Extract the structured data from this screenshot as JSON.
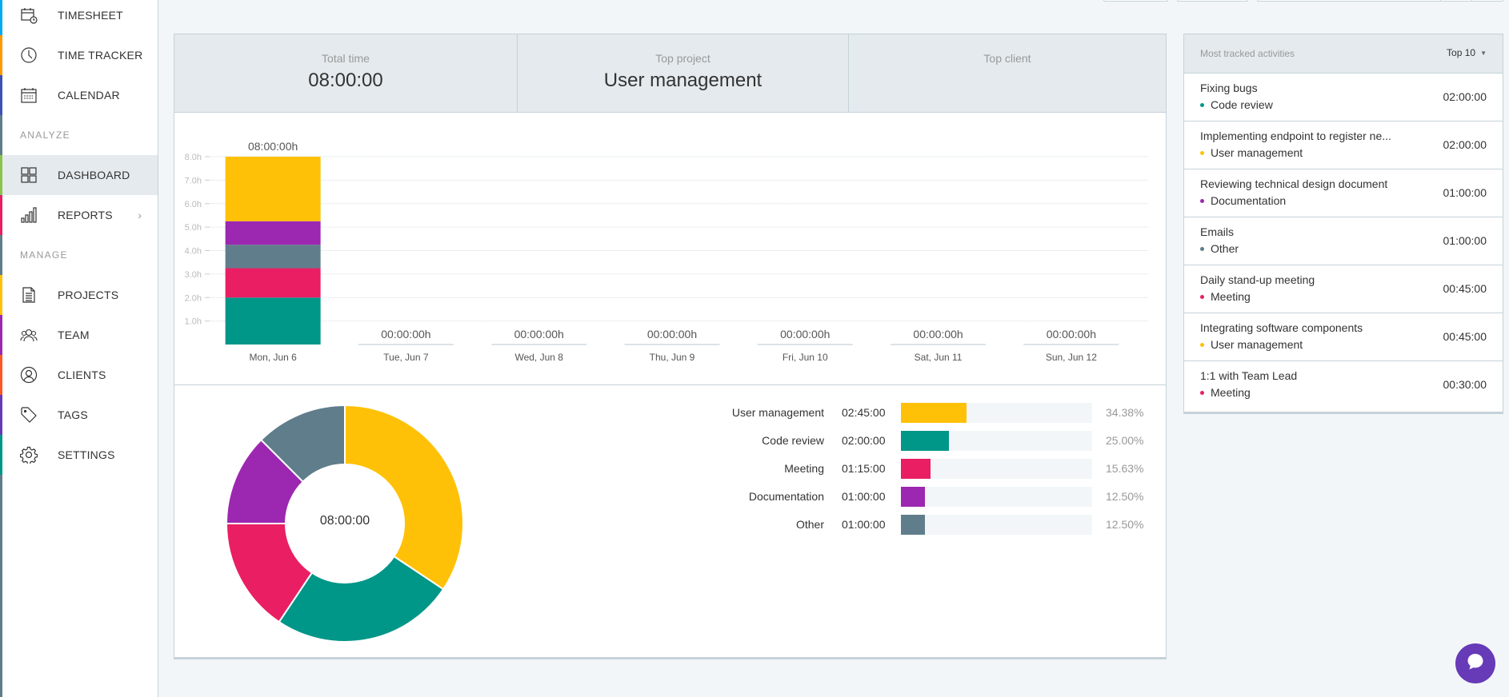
{
  "sidebar": {
    "items": [
      {
        "key": "timesheet",
        "label": "TIMESHEET",
        "icon": "timesheet-icon",
        "color": "#03a9f4"
      },
      {
        "key": "time-tracker",
        "label": "TIME TRACKER",
        "icon": "clock-icon",
        "color": "#ff9800"
      },
      {
        "key": "calendar",
        "label": "CALENDAR",
        "icon": "calendar-icon",
        "color": "#3f51b5"
      },
      {
        "key": "dashboard",
        "label": "DASHBOARD",
        "icon": "dashboard-grid-icon",
        "color": "#8bc34a",
        "active": true
      },
      {
        "key": "reports",
        "label": "REPORTS",
        "icon": "bar-chart-icon",
        "color": "#e91e63",
        "has_submenu": true
      },
      {
        "key": "projects",
        "label": "PROJECTS",
        "icon": "document-icon",
        "color": "#ffc107"
      },
      {
        "key": "team",
        "label": "TEAM",
        "icon": "team-icon",
        "color": "#9c27b0"
      },
      {
        "key": "clients",
        "label": "CLIENTS",
        "icon": "client-icon",
        "color": "#ff5722"
      },
      {
        "key": "tags",
        "label": "TAGS",
        "icon": "tag-icon",
        "color": "#673ab7"
      },
      {
        "key": "settings",
        "label": "SETTINGS",
        "icon": "gear-icon",
        "color": "#009688"
      }
    ],
    "sections": {
      "analyze": "ANALYZE",
      "manage": "MANAGE"
    },
    "reports_chevron": "›"
  },
  "summary": {
    "total_time_label": "Total time",
    "total_time_value": "08:00:00",
    "top_project_label": "Top project",
    "top_project_value": "User management",
    "top_client_label": "Top client",
    "top_client_value": ""
  },
  "activities": {
    "title": "Most tracked activities",
    "top_selector": "Top 10",
    "items": [
      {
        "description": "Fixing bugs",
        "project": "Code review",
        "color": "#009688",
        "duration": "02:00:00"
      },
      {
        "description": "Implementing endpoint to register ne...",
        "project": "User management",
        "color": "#ffc107",
        "duration": "02:00:00"
      },
      {
        "description": "Reviewing technical design document",
        "project": "Documentation",
        "color": "#9c27b0",
        "duration": "01:00:00"
      },
      {
        "description": "Emails",
        "project": "Other",
        "color": "#607d8b",
        "duration": "01:00:00"
      },
      {
        "description": "Daily stand-up meeting",
        "project": "Meeting",
        "color": "#e91e63",
        "duration": "00:45:00"
      },
      {
        "description": "Integrating software components",
        "project": "User management",
        "color": "#ffc107",
        "duration": "00:45:00"
      },
      {
        "description": "1:1 with Team Lead",
        "project": "Meeting",
        "color": "#e91e63",
        "duration": "00:30:00"
      }
    ]
  },
  "chat": {
    "icon": "chat-bubble-icon",
    "color": "#673ab7"
  },
  "chart_data": [
    {
      "type": "bar",
      "stacked": true,
      "title": "",
      "xlabel": "",
      "ylabel": "",
      "ylim": [
        0,
        8
      ],
      "yticks": [
        "1.0h",
        "2.0h",
        "3.0h",
        "4.0h",
        "5.0h",
        "6.0h",
        "7.0h",
        "8.0h"
      ],
      "grid": true,
      "categories": [
        "Mon, Jun 6",
        "Tue, Jun 7",
        "Wed, Jun 8",
        "Thu, Jun 9",
        "Fri, Jun 10",
        "Sat, Jun 11",
        "Sun, Jun 12"
      ],
      "totals": [
        "08:00:00h",
        "00:00:00h",
        "00:00:00h",
        "00:00:00h",
        "00:00:00h",
        "00:00:00h",
        "00:00:00h"
      ],
      "series": [
        {
          "name": "Code review",
          "color": "#009688",
          "values": [
            2.0,
            0,
            0,
            0,
            0,
            0,
            0
          ]
        },
        {
          "name": "Meeting",
          "color": "#e91e63",
          "values": [
            1.25,
            0,
            0,
            0,
            0,
            0,
            0
          ]
        },
        {
          "name": "Other",
          "color": "#607d8b",
          "values": [
            1.0,
            0,
            0,
            0,
            0,
            0,
            0
          ]
        },
        {
          "name": "Documentation",
          "color": "#9c27b0",
          "values": [
            1.0,
            0,
            0,
            0,
            0,
            0,
            0
          ]
        },
        {
          "name": "User management",
          "color": "#ffc107",
          "values": [
            2.75,
            0,
            0,
            0,
            0,
            0,
            0
          ]
        }
      ]
    },
    {
      "type": "pie",
      "donut": true,
      "center_label": "08:00:00",
      "legend": "right",
      "slices": [
        {
          "name": "User management",
          "value": 2.75,
          "time": "02:45:00",
          "percent": "34.38%",
          "color": "#ffc107"
        },
        {
          "name": "Code review",
          "value": 2.0,
          "time": "02:00:00",
          "percent": "25.00%",
          "color": "#009688"
        },
        {
          "name": "Meeting",
          "value": 1.25,
          "time": "01:15:00",
          "percent": "15.63%",
          "color": "#e91e63"
        },
        {
          "name": "Documentation",
          "value": 1.0,
          "time": "01:00:00",
          "percent": "12.50%",
          "color": "#9c27b0"
        },
        {
          "name": "Other",
          "value": 1.0,
          "time": "01:00:00",
          "percent": "12.50%",
          "color": "#607d8b"
        }
      ]
    }
  ]
}
